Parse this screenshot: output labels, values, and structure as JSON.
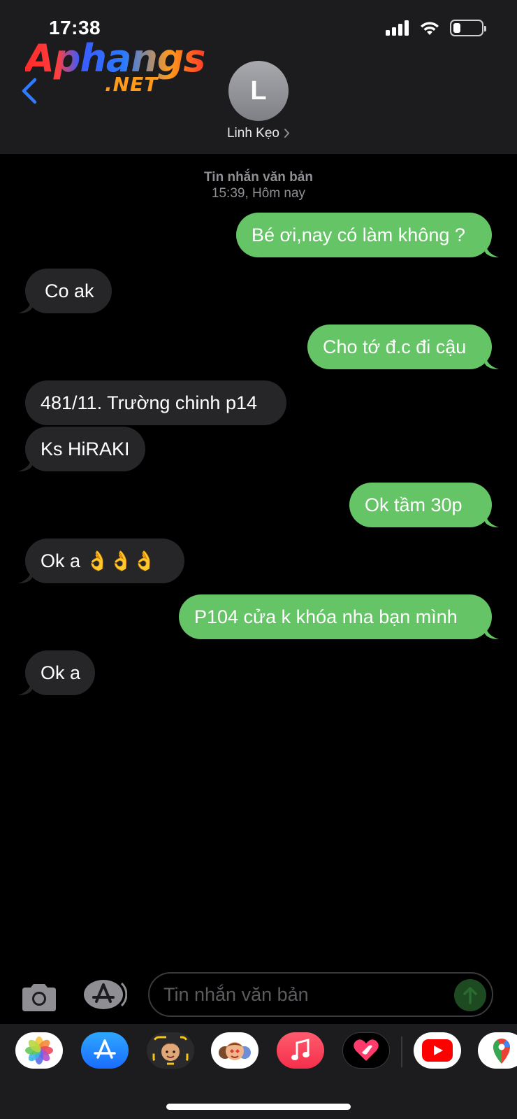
{
  "status_bar": {
    "time": "17:38",
    "signal_icon": "signal-bars-icon",
    "wifi_icon": "wifi-icon",
    "battery_level": 0.25
  },
  "watermark": {
    "main": "Aphangs",
    "sub": ".NET"
  },
  "header": {
    "back_icon": "chevron-left-icon",
    "avatar_initial": "L",
    "contact_name": "Linh Kẹo",
    "contact_chevron_icon": "chevron-right-icon"
  },
  "conversation": {
    "timestamp_title": "Tin nhắn văn bản",
    "timestamp_time": "15:39, Hôm nay",
    "messages": [
      {
        "direction": "out",
        "text": "Bé ơi,nay có làm không ?"
      },
      {
        "direction": "in",
        "text": "Co ak"
      },
      {
        "direction": "out",
        "text": "Cho tớ đ.c đi cậu"
      },
      {
        "direction": "in",
        "text": "481/11.  Trường chinh p14"
      },
      {
        "direction": "in",
        "text": "Ks HiRAKI"
      },
      {
        "direction": "out",
        "text": "Ok tầm 30p"
      },
      {
        "direction": "in",
        "text": "Ok a 👌👌👌"
      },
      {
        "direction": "out",
        "text": "P104 cửa k khóa nha bạn mình"
      },
      {
        "direction": "in",
        "text": "Ok a"
      }
    ]
  },
  "composer": {
    "camera_icon": "camera-icon",
    "apps_icon": "app-store-icon",
    "placeholder": "Tin nhắn văn bản",
    "send_icon": "send-arrow-icon"
  },
  "app_drawer": {
    "apps": [
      "photos-icon",
      "app-store-icon",
      "memoji-icon",
      "animoji-stickers-icon",
      "music-icon",
      "digital-touch-icon",
      "youtube-icon",
      "google-maps-icon"
    ]
  },
  "colors": {
    "outgoing_bubble": "#65c466",
    "incoming_bubble": "#262628",
    "header_bg": "#1c1c1e",
    "accent_blue": "#2f7bff"
  }
}
